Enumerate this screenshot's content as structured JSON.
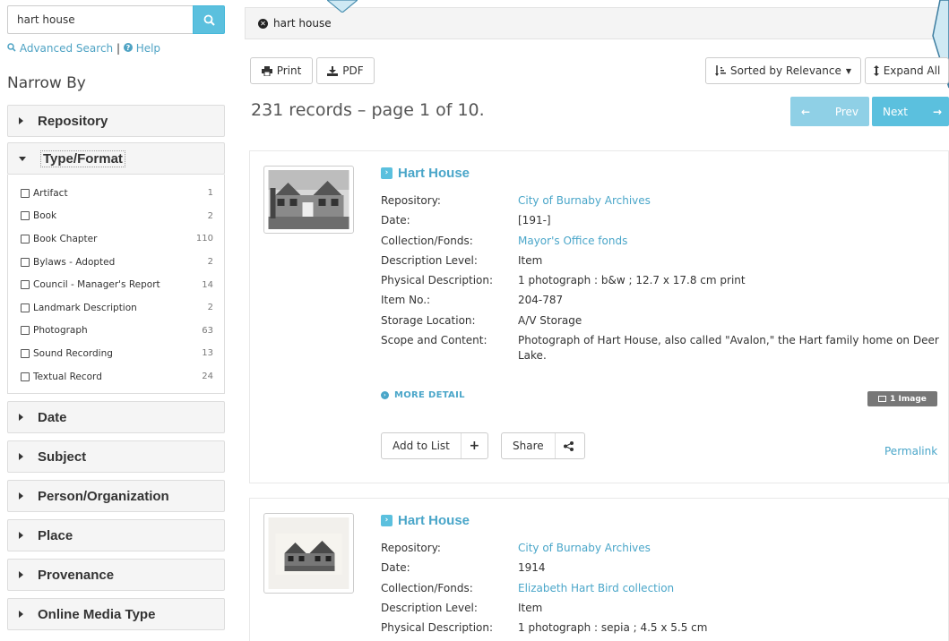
{
  "search": {
    "value": "hart house"
  },
  "sidebar": {
    "advanced_search": "Advanced Search",
    "separator": "|",
    "help": "Help",
    "narrow_by": "Narrow By",
    "facets_top": [
      {
        "label": "Repository"
      }
    ],
    "open_facet": {
      "label": "Type/Format",
      "items": [
        {
          "label": "Artifact",
          "count": "1"
        },
        {
          "label": "Book",
          "count": "2"
        },
        {
          "label": "Book Chapter",
          "count": "110"
        },
        {
          "label": "Bylaws - Adopted",
          "count": "2"
        },
        {
          "label": "Council - Manager's Report",
          "count": "14"
        },
        {
          "label": "Landmark Description",
          "count": "2"
        },
        {
          "label": "Photograph",
          "count": "63"
        },
        {
          "label": "Sound Recording",
          "count": "13"
        },
        {
          "label": "Textual Record",
          "count": "24"
        }
      ]
    },
    "facets_bottom": [
      {
        "label": "Date"
      },
      {
        "label": "Subject"
      },
      {
        "label": "Person/Organization"
      },
      {
        "label": "Place"
      },
      {
        "label": "Provenance"
      },
      {
        "label": "Online Media Type"
      }
    ]
  },
  "query_chip": "hart house",
  "toolbar": {
    "print": "Print",
    "pdf": "PDF",
    "sort": "Sorted by Relevance",
    "expand": "Expand All"
  },
  "results_summary": "231 records – page 1 of 10.",
  "pager": {
    "prev": "Prev",
    "next": "Next"
  },
  "results": [
    {
      "title": "Hart House",
      "fields": [
        {
          "k": "Repository:",
          "v": "City of Burnaby Archives",
          "link": true
        },
        {
          "k": "Date:",
          "v": "[191-]",
          "link": false
        },
        {
          "k": "Collection/Fonds:",
          "v": "Mayor's Office fonds",
          "link": true
        },
        {
          "k": "Description Level:",
          "v": "Item",
          "link": false
        },
        {
          "k": "Physical Description:",
          "v": "1 photograph : b&w ; 12.7 x 17.8 cm print",
          "link": false
        },
        {
          "k": "Item No.:",
          "v": "204-787",
          "link": false
        },
        {
          "k": "Storage Location:",
          "v": "A/V Storage",
          "link": false
        },
        {
          "k": "Scope and Content:",
          "v": "Photograph of Hart House, also called \"Avalon,\" the Hart family home on Deer Lake.",
          "link": false
        }
      ],
      "more_detail": "MORE DETAIL",
      "image_badge": "1 Image",
      "add_to_list": "Add to List",
      "share": "Share",
      "permalink": "Permalink"
    },
    {
      "title": "Hart House",
      "fields": [
        {
          "k": "Repository:",
          "v": "City of Burnaby Archives",
          "link": true
        },
        {
          "k": "Date:",
          "v": "1914",
          "link": false
        },
        {
          "k": "Collection/Fonds:",
          "v": "Elizabeth Hart Bird collection",
          "link": true
        },
        {
          "k": "Description Level:",
          "v": "Item",
          "link": false
        },
        {
          "k": "Physical Description:",
          "v": "1 photograph : sepia ; 4.5 x 5.5 cm",
          "link": false
        }
      ]
    }
  ],
  "colors": {
    "accent": "#5bc0de",
    "link": "#4aa6c9",
    "pager_disabled": "#8fd0e6"
  }
}
